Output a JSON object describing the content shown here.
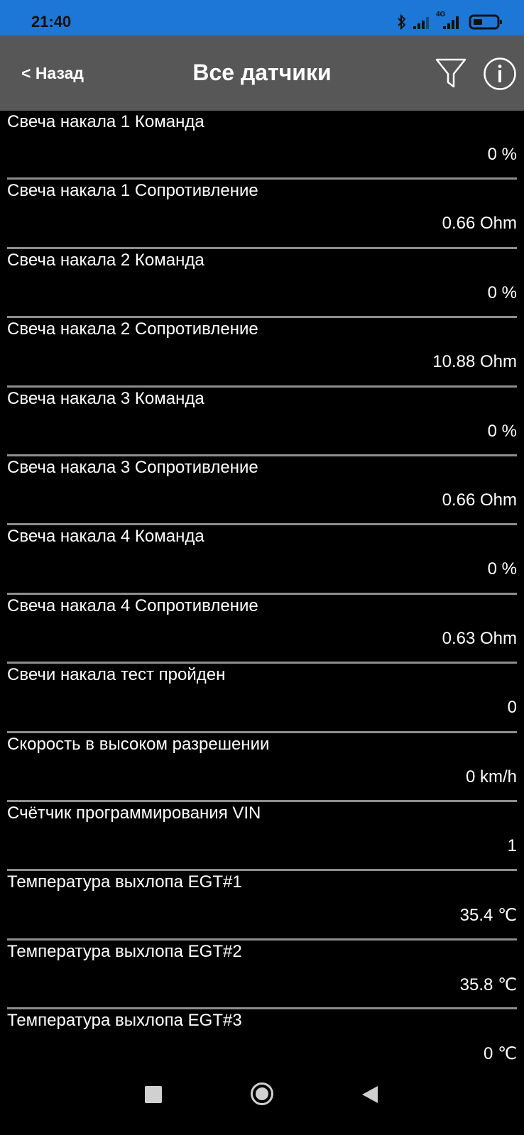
{
  "status_bar": {
    "time": "21:40",
    "network_label": "4G",
    "icons": [
      "bluetooth-icon",
      "signal-icon",
      "signal-4g-icon",
      "battery-icon"
    ],
    "background": "#1c77d6"
  },
  "header": {
    "back_label": "< Назад",
    "title": "Все датчики",
    "filter_icon": "filter-icon",
    "info_icon": "info-icon",
    "background": "#575757"
  },
  "sensors": [
    {
      "name": "Свеча накала 1 Команда",
      "value": "0 %"
    },
    {
      "name": "Свеча накала 1 Сопротивление",
      "value": "0.66 Ohm"
    },
    {
      "name": "Свеча накала 2 Команда",
      "value": "0 %"
    },
    {
      "name": "Свеча накала 2 Сопротивление",
      "value": "10.88 Ohm"
    },
    {
      "name": "Свеча накала 3 Команда",
      "value": "0 %"
    },
    {
      "name": "Свеча накала 3 Сопротивление",
      "value": "0.66 Ohm"
    },
    {
      "name": "Свеча накала 4 Команда",
      "value": "0 %"
    },
    {
      "name": "Свеча накала 4 Сопротивление",
      "value": "0.63 Ohm"
    },
    {
      "name": "Свечи накала тест пройден",
      "value": "0"
    },
    {
      "name": "Скорость в высоком разрешении",
      "value": "0 km/h"
    },
    {
      "name": "Счётчик программирования VIN",
      "value": "1"
    },
    {
      "name": "Температура выхлопа EGT#1",
      "value": "35.4 ℃"
    },
    {
      "name": "Температура выхлопа EGT#2",
      "value": "35.8 ℃"
    },
    {
      "name": "Температура выхлопа EGT#3",
      "value": "0 ℃"
    }
  ],
  "nav_bar": {
    "icons": [
      "recents-square-icon",
      "home-circle-icon",
      "back-triangle-icon"
    ]
  }
}
